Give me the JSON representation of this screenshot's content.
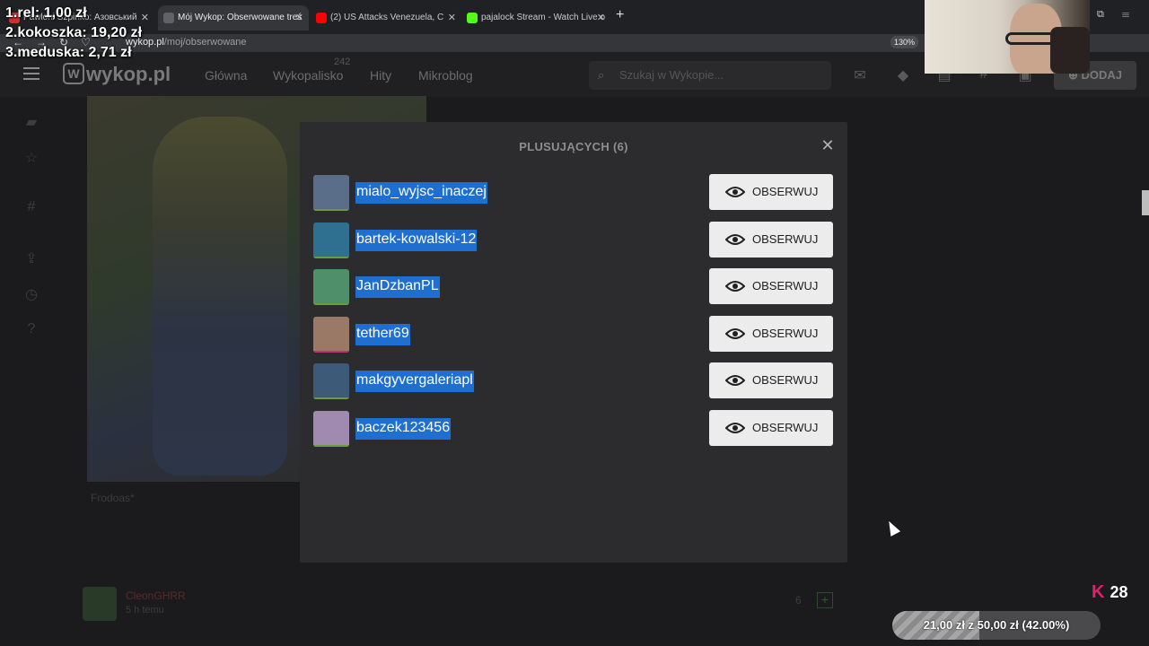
{
  "browser": {
    "tabs": [
      {
        "label": "Pawloni Szpinko: Азовський",
        "fav_color": "#d32f2f"
      },
      {
        "label": "Mój Wykop: Obserwowane treś",
        "fav_color": "#5f6368"
      },
      {
        "label": "(2) US Attacks Venezuela, C",
        "fav_color": "#ff0000"
      },
      {
        "label": "pajalock Stream - Watch Live o",
        "fav_color": "#53fc18"
      }
    ],
    "url_host": "wykop.pl",
    "url_path": "/moj/obserwowane",
    "zoom": "130%"
  },
  "ranking": [
    {
      "label": "1.rel:",
      "amount": "1,00 zł"
    },
    {
      "label": "2.kokoszka:",
      "amount": "19,20 zł"
    },
    {
      "label": "3.meduska:",
      "amount": "2,71 zł"
    }
  ],
  "site": {
    "logo": "wykop.pl",
    "nav": [
      "Główna",
      "Wykopalisko",
      "Hity",
      "Mikroblog"
    ],
    "wykopalisko_count": "242",
    "search_placeholder": "Szukaj w Wykopie...",
    "add_label": "DODAJ",
    "post_author": "Frodoas*",
    "bottom_comment_author": "CleonGHRR",
    "bottom_comment_time": "5 h temu",
    "bottom_count": "6"
  },
  "modal": {
    "title": "PLUSUJĄCYCH (6)",
    "follow_label": "OBSERWUJ",
    "users": [
      {
        "name": "mialo_wyjsc_inaczej",
        "avatar_color": "#5a6e8a",
        "bar_color": "#6f9a3a"
      },
      {
        "name": "bartek-kowalski-12",
        "avatar_color": "#2f6f8f",
        "bar_color": "#6f9a3a"
      },
      {
        "name": "JanDzbanPL",
        "avatar_color": "#4f8f6a",
        "bar_color": "#6f9a3a"
      },
      {
        "name": "tether69",
        "avatar_color": "#9a7a66",
        "bar_color": "#c0307a"
      },
      {
        "name": "makgyvergaleriapl",
        "avatar_color": "#3d5a78",
        "bar_color": "#6f9a3a"
      },
      {
        "name": "baczek123456",
        "avatar_color": "#a08ab0",
        "bar_color": "#6f9a3a"
      }
    ]
  },
  "stream": {
    "viewers": "28",
    "goal_text": "21,00 zł z 50,00 zł (42.00%)",
    "goal_progress": 0.42
  }
}
